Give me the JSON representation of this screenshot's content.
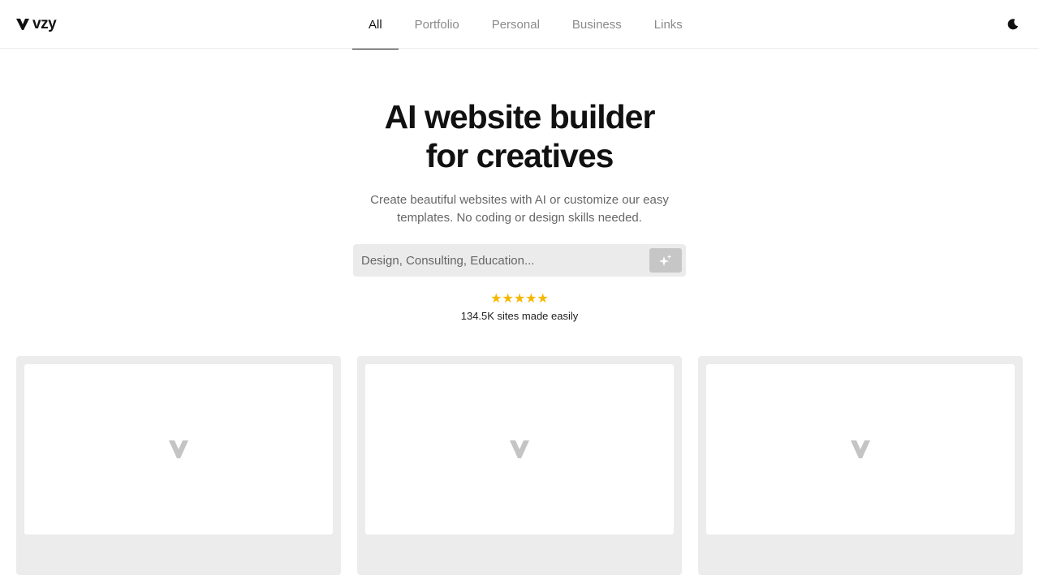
{
  "header": {
    "logo_text": "vzy",
    "logo_icon": "v-logo-icon",
    "nav": [
      {
        "label": "All",
        "active": true
      },
      {
        "label": "Portfolio",
        "active": false
      },
      {
        "label": "Personal",
        "active": false
      },
      {
        "label": "Business",
        "active": false
      },
      {
        "label": "Links",
        "active": false
      }
    ],
    "theme_icon": "moon-icon"
  },
  "hero": {
    "title_line1": "AI website builder",
    "title_line2": "for creatives",
    "subtitle": "Create beautiful websites with AI or customize our easy templates. No coding or design skills needed."
  },
  "search": {
    "placeholder": "Design, Consulting, Education...",
    "value": "",
    "button_icon": "sparkle-icon"
  },
  "rating": {
    "stars": "★★★★★",
    "star_count": 5,
    "caption": "134.5K sites made easily",
    "star_color": "#f5b800"
  },
  "templates": [
    {
      "placeholder_icon": "v-logo-placeholder-icon"
    },
    {
      "placeholder_icon": "v-logo-placeholder-icon"
    },
    {
      "placeholder_icon": "v-logo-placeholder-icon"
    }
  ],
  "colors": {
    "text": "#111111",
    "muted": "#8a8a8a",
    "card_bg": "#ececec",
    "search_bg": "#ebebeb",
    "button_bg": "#c6c6c6"
  }
}
